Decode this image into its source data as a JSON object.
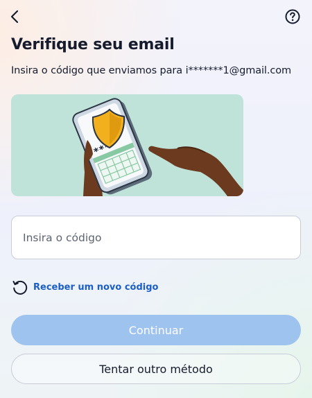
{
  "header": {
    "back_icon": "chevron-left-icon",
    "help_icon": "question-circle-icon"
  },
  "title": "Verifique seu email",
  "subtitle": "Insira o código que enviamos para i*******1@gmail.com",
  "illustration": {
    "icon": "phone-with-shield-and-password-illustration",
    "password_mask": "****",
    "background_color": "#bfe3d9",
    "shield_color": "#f2b01e"
  },
  "code_input": {
    "value": "",
    "placeholder": "Insira o código"
  },
  "resend": {
    "icon": "refresh-icon",
    "label": "Receber um novo código"
  },
  "buttons": {
    "continue_label": "Continuar",
    "other_method_label": "Tentar outro método"
  },
  "colors": {
    "link": "#1a5fc7",
    "primary_disabled": "#9fc3ef",
    "text": "#161c2d"
  }
}
